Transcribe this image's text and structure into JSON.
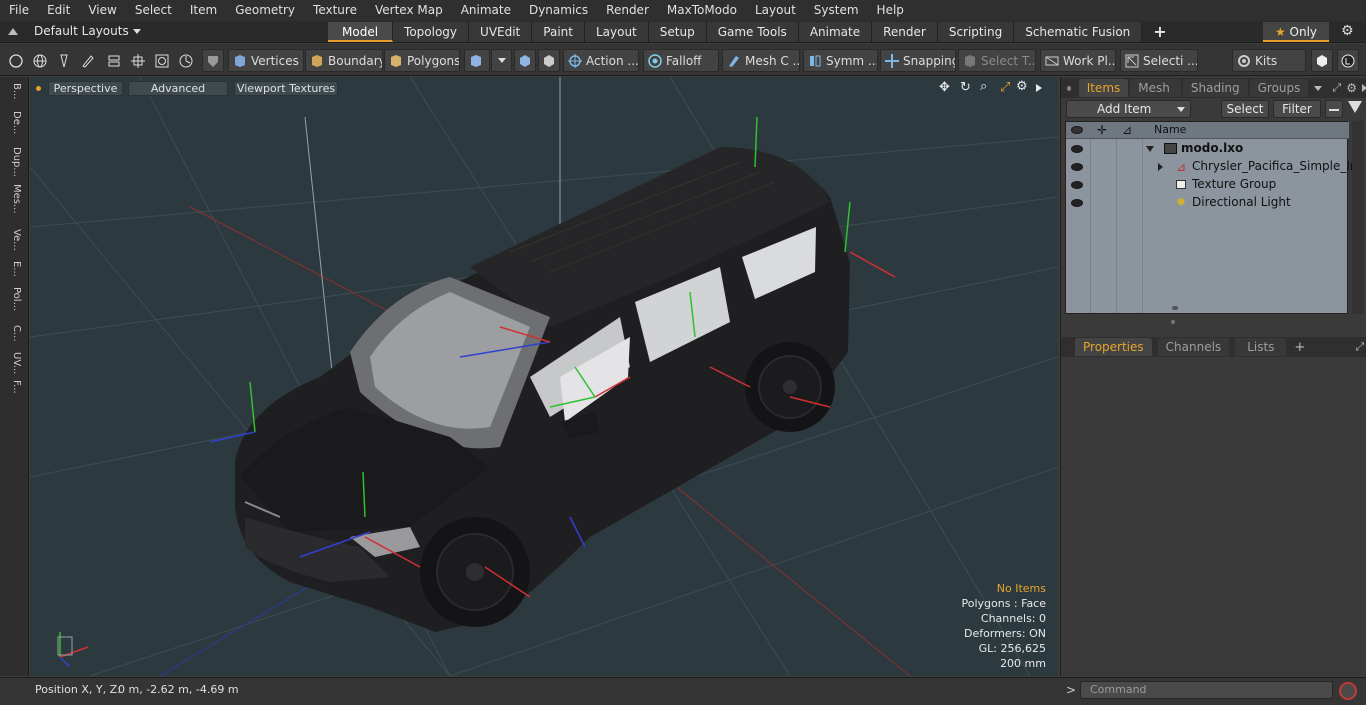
{
  "menu": [
    "File",
    "Edit",
    "View",
    "Select",
    "Item",
    "Geometry",
    "Texture",
    "Vertex Map",
    "Animate",
    "Dynamics",
    "Render",
    "MaxToModo",
    "Layout",
    "System",
    "Help"
  ],
  "layout": {
    "selector": "Default Layouts",
    "tabs": [
      "Model",
      "Topology",
      "UVEdit",
      "Paint",
      "Layout",
      "Setup",
      "Game Tools",
      "Animate",
      "Render",
      "Scripting",
      "Schematic Fusion"
    ],
    "active_tab": "Model",
    "add_tab": "+",
    "only_label": "Only"
  },
  "toolbar": {
    "vertices": "Vertices",
    "boundary": "Boundary",
    "polygons": "Polygons",
    "action": "Action ...",
    "falloff": "Falloff",
    "mesh": "Mesh C ...",
    "symmetry": "Symm ...",
    "snapping": "Snapping",
    "select_t": "Select T...",
    "work_plane": "Work Pl...",
    "selection": "Selecti ...",
    "kits": "Kits"
  },
  "left_tabs": [
    "B...",
    "De...",
    "Dup...",
    "Mes...",
    "Ve...",
    "E...",
    "Pol...",
    "C...",
    "UV...",
    "F..."
  ],
  "viewport": {
    "perspective": "Perspective",
    "advanced": "Advanced",
    "textures": "Viewport Textures",
    "info": {
      "no_items": "No Items",
      "polygons": "Polygons : Face",
      "channels": "Channels: 0",
      "deformers": "Deformers: ON",
      "gl": "GL: 256,625",
      "scale": "200 mm"
    }
  },
  "items_panel": {
    "tabs": [
      "Items",
      "Mesh ...",
      "Shading",
      "Groups"
    ],
    "active_tab": "Items",
    "add_item": "Add Item",
    "select": "Select",
    "filter": "Filter",
    "name_header": "Name",
    "tree": [
      {
        "label": "modo.lxo",
        "bold": true
      },
      {
        "label": "Chrysler_Pacifica_Simple_Int ...",
        "bold": false
      },
      {
        "label": "Texture Group",
        "bold": false
      },
      {
        "label": "Directional Light",
        "bold": false
      }
    ]
  },
  "props_panel": {
    "tabs": [
      "Properties",
      "Channels",
      "Lists"
    ],
    "active_tab": "Properties",
    "add": "+"
  },
  "status": {
    "position_label": "Position X, Y, Z:",
    "position_value": "0 m, -2.62 m, -4.69 m",
    "command_placeholder": "Command",
    "prompt": ">"
  },
  "colors": {
    "accent": "#e59e2d",
    "viewport_bg": "#2c3a3f",
    "axis_x": "#d03030",
    "axis_y": "#30c030",
    "axis_z": "#3040d0"
  }
}
